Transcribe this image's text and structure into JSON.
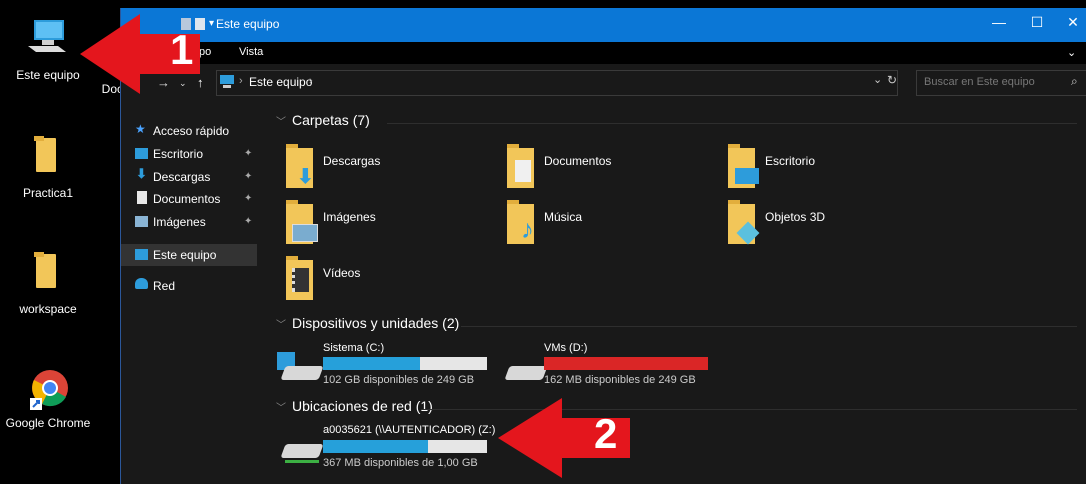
{
  "desktop": {
    "icons": [
      {
        "label": "Este equipo"
      },
      {
        "label": "Doc"
      },
      {
        "label": "Practica1"
      },
      {
        "label": "workspace"
      },
      {
        "label": "Google Chrome"
      }
    ]
  },
  "window": {
    "title": "Este equipo",
    "ribbon": {
      "tab_partial": "po",
      "tab_vista": "Vista"
    },
    "address": {
      "path": "Este equipo",
      "search_placeholder": "Buscar en Este equipo"
    }
  },
  "navpane": {
    "items": [
      {
        "label": "Acceso rápido"
      },
      {
        "label": "Escritorio"
      },
      {
        "label": "Descargas"
      },
      {
        "label": "Documentos"
      },
      {
        "label": "Imágenes"
      },
      {
        "label": "Este equipo"
      },
      {
        "label": "Red"
      }
    ]
  },
  "groups": {
    "folders": {
      "header": "Carpetas (7)",
      "items": [
        {
          "label": "Descargas"
        },
        {
          "label": "Documentos"
        },
        {
          "label": "Escritorio"
        },
        {
          "label": "Imágenes"
        },
        {
          "label": "Música"
        },
        {
          "label": "Objetos 3D"
        },
        {
          "label": "Vídeos"
        }
      ]
    },
    "drives": {
      "header": "Dispositivos y unidades (2)",
      "items": [
        {
          "name": "Sistema (C:)",
          "free": "102 GB disponibles de 249 GB",
          "used_fraction": 0.59,
          "color": "#26a0da"
        },
        {
          "name": "VMs (D:)",
          "free": "162 MB disponibles de 249 GB",
          "used_fraction": 1.0,
          "color": "#da2626"
        }
      ]
    },
    "network": {
      "header": "Ubicaciones de red (1)",
      "items": [
        {
          "name": "a0035621 (\\\\AUTENTICADOR) (Z:)",
          "free": "367 MB disponibles de 1,00 GB",
          "used_fraction": 0.64,
          "color": "#26a0da"
        }
      ]
    }
  },
  "annotations": {
    "arrow1": "1",
    "arrow2": "2"
  },
  "colors": {
    "accent": "#0b77d6",
    "arrow": "#e4161d"
  }
}
